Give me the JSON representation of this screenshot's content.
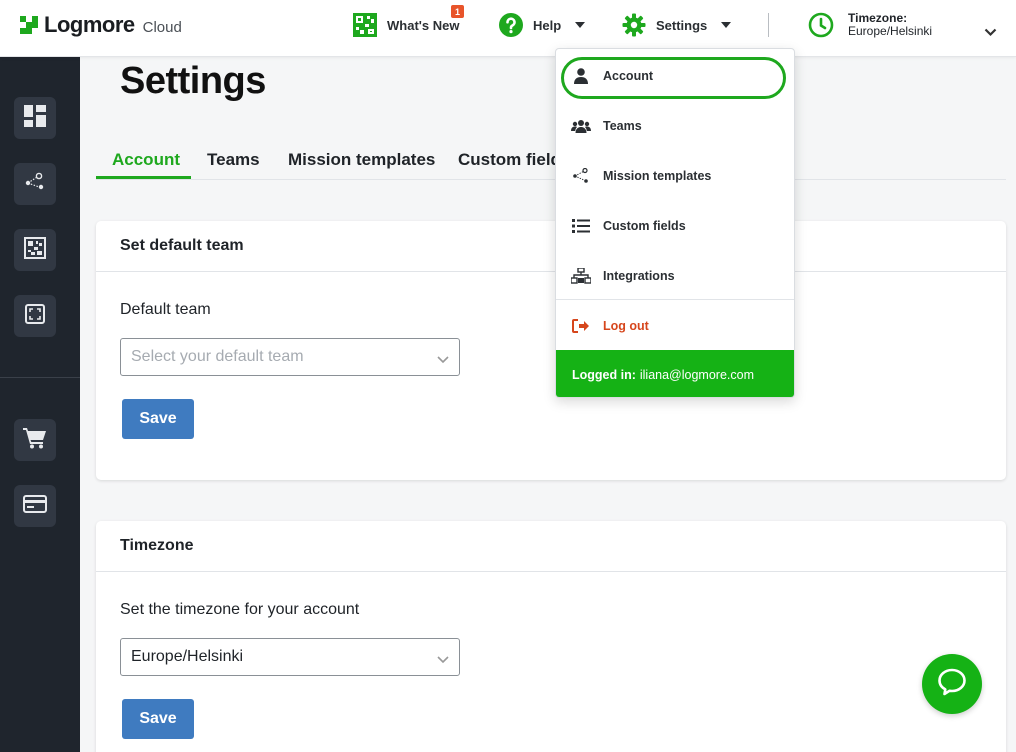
{
  "brand": {
    "name": "Logmore",
    "sub": "Cloud",
    "accent": "#1ea81e",
    "dark_sidebar": "#1f252d"
  },
  "topbar": {
    "whats_new_label": "What's New",
    "whats_new_badge": "1",
    "help_label": "Help",
    "settings_label": "Settings",
    "timezone_label": "Timezone:",
    "timezone_value": "Europe/Helsinki"
  },
  "sidebar": {
    "items": [
      {
        "icon": "dashboard-icon"
      },
      {
        "icon": "mission-icon"
      },
      {
        "icon": "qr-code-icon"
      },
      {
        "icon": "scan-icon"
      },
      {
        "icon": "cart-icon"
      },
      {
        "icon": "credit-card-icon"
      }
    ]
  },
  "page": {
    "title": "Settings",
    "tabs": [
      {
        "label": "Account",
        "active": true
      },
      {
        "label": "Teams"
      },
      {
        "label": "Mission templates"
      },
      {
        "label": "Custom fields"
      }
    ]
  },
  "default_team": {
    "heading": "Set default team",
    "field_label": "Default team",
    "placeholder": "Select your default team",
    "save_label": "Save"
  },
  "timezone_card": {
    "heading": "Timezone",
    "field_label": "Set the timezone for your account",
    "value": "Europe/Helsinki",
    "save_label": "Save"
  },
  "settings_menu": {
    "items": [
      {
        "label": "Account",
        "icon": "user-icon"
      },
      {
        "label": "Teams",
        "icon": "users-icon"
      },
      {
        "label": "Mission templates",
        "icon": "share-icon"
      },
      {
        "label": "Custom fields",
        "icon": "list-icon"
      },
      {
        "label": "Integrations",
        "icon": "sitemap-icon"
      }
    ],
    "logout_label": "Log out",
    "logged_in_label": "Logged in:",
    "logged_in_email": "iliana@logmore.com"
  }
}
